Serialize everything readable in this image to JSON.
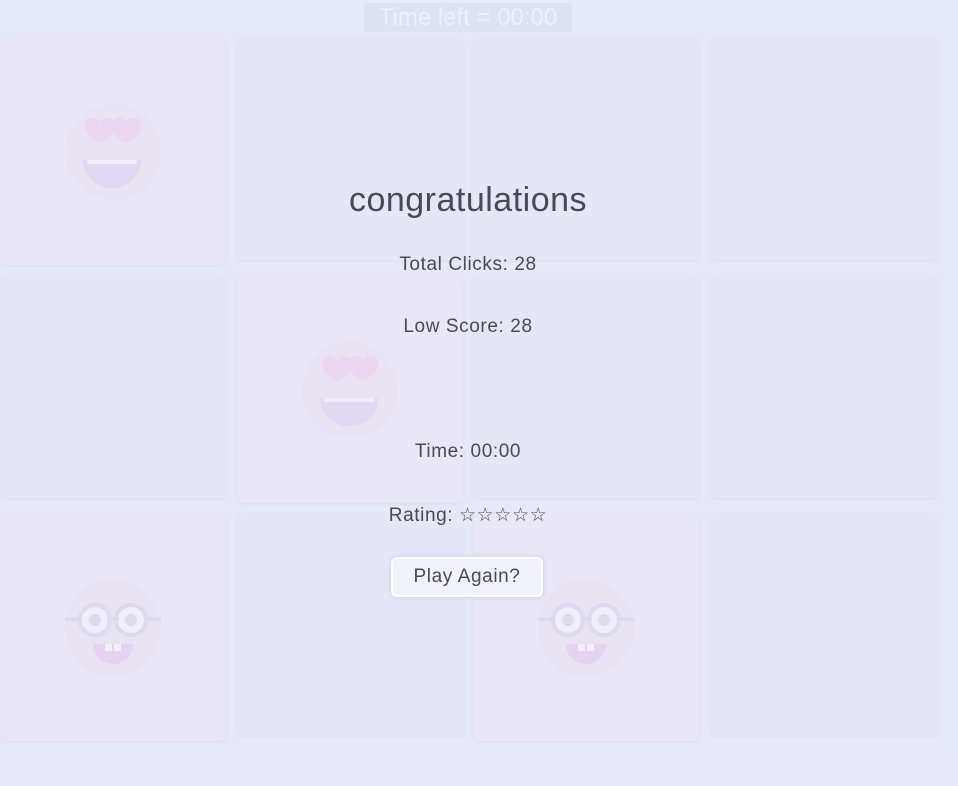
{
  "header": {
    "timer_text": "Time left = 00:00"
  },
  "board": {
    "cards": [
      {
        "emoji": "heart-eyes-face-icon",
        "revealed": true
      },
      {
        "emoji": "",
        "revealed": false
      },
      {
        "emoji": "",
        "revealed": false
      },
      {
        "emoji": "",
        "revealed": false
      },
      {
        "emoji": "",
        "revealed": false
      },
      {
        "emoji": "heart-eyes-face-icon",
        "revealed": true
      },
      {
        "emoji": "",
        "revealed": false
      },
      {
        "emoji": "",
        "revealed": false
      },
      {
        "emoji": "nerd-face-icon",
        "revealed": true
      },
      {
        "emoji": "",
        "revealed": false
      },
      {
        "emoji": "nerd-face-icon",
        "revealed": true
      },
      {
        "emoji": "",
        "revealed": false
      }
    ]
  },
  "modal": {
    "title": "congratulations",
    "total_clicks": "Total Clicks: 28",
    "low_score": "Low Score: 28",
    "time": "Time: 00:00",
    "rating": "Rating: ☆☆☆☆☆",
    "play_again_label": "Play Again?"
  },
  "colors": {
    "background": "#e4e6f7",
    "card": "#e2e4f8",
    "text": "#4a4a52"
  }
}
